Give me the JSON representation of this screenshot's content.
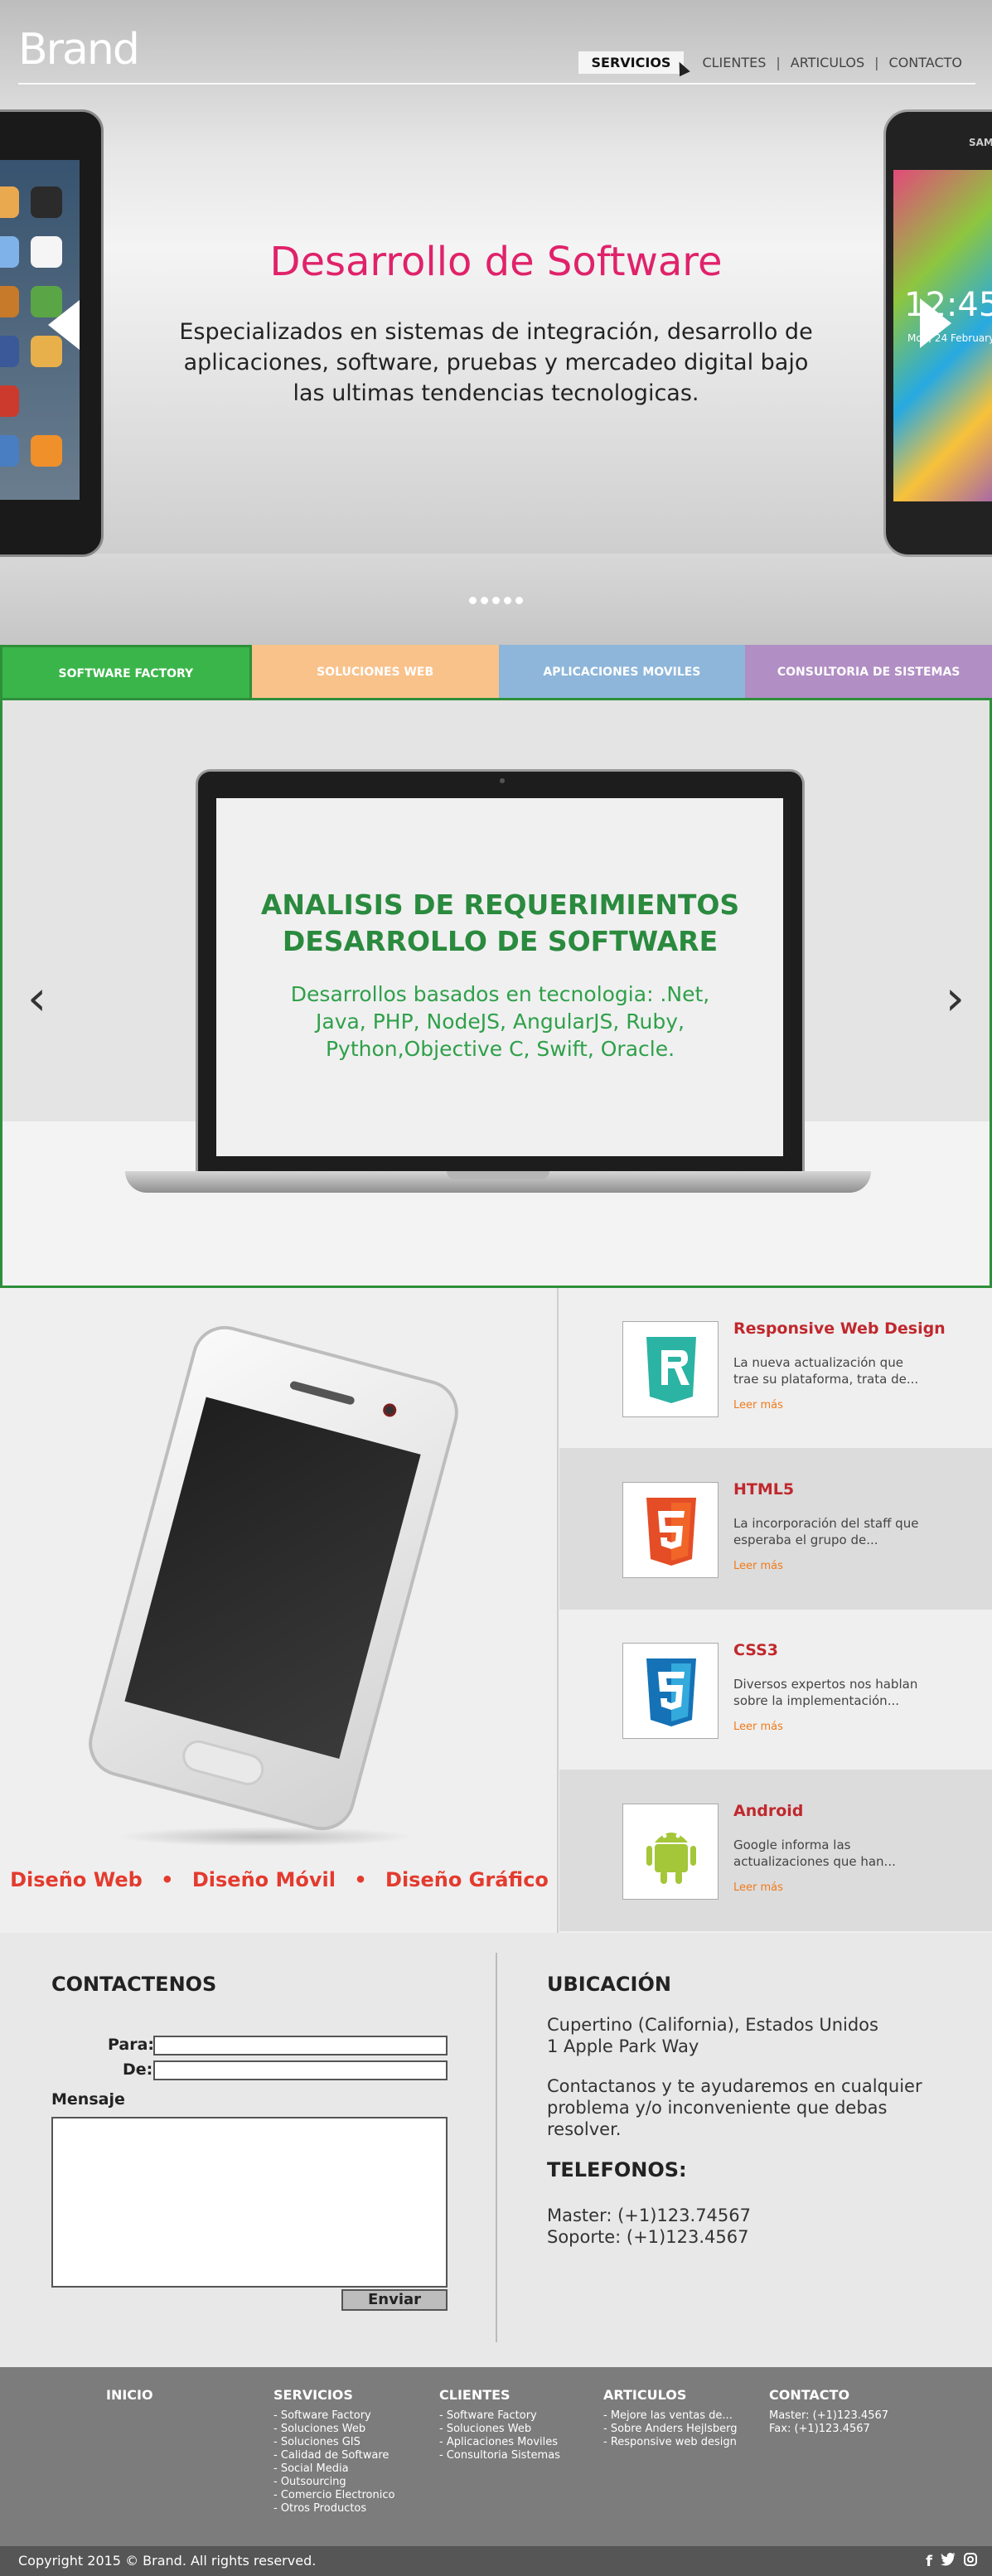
{
  "header": {
    "logo": "Brand",
    "nav": [
      {
        "label": "SERVICIOS",
        "active": true
      },
      {
        "label": "CLIENTES",
        "active": false
      },
      {
        "label": "ARTICULOS",
        "active": false
      },
      {
        "label": "CONTACTO",
        "active": false
      }
    ]
  },
  "hero": {
    "title": "Desarrollo de Software",
    "text": "Especializados en sistemas de integración, desarrollo de aplicaciones, software, pruebas y mercadeo digital bajo las ultimas tendencias tecnologicas.",
    "phone_right_brand": "SAMS",
    "phone_right_time": "12:45",
    "phone_right_date": "Mon, 24 February",
    "slide_count": 5
  },
  "tabs": [
    {
      "label": "SOFTWARE FACTORY",
      "color": "#3ab54a"
    },
    {
      "label": "SOLUCIONES WEB",
      "color": "#f9c28b"
    },
    {
      "label": "APLICACIONES MOVILES",
      "color": "#8db6da"
    },
    {
      "label": "CONSULTORIA DE SISTEMAS",
      "color": "#b18ec4"
    }
  ],
  "slide": {
    "title_line1": "ANALISIS DE REQUERIMIENTOS",
    "title_line2": "DESARROLLO DE SOFTWARE",
    "text": "Desarrollos basados en tecnologia: .Net, Java, PHP, NodeJS, AngularJS, Ruby, Python,Objective C, Swift, Oracle.",
    "prev_icon": "‹",
    "next_icon": "›"
  },
  "design": {
    "items": [
      "Diseño Web",
      "Diseño Móvil",
      "Diseño Gráfico"
    ],
    "bullet": "•"
  },
  "features": [
    {
      "title": "Responsive Web Design",
      "desc": "La nueva actualización que trae su plataforma, trata de...",
      "more": "Leer más",
      "icon": "responsive-icon",
      "icon_color": "#2bb3a3"
    },
    {
      "title": "HTML5",
      "desc": "La incorporación del staff que esperaba el grupo de...",
      "more": "Leer más",
      "icon": "html5-icon",
      "icon_color": "#e44d26"
    },
    {
      "title": "CSS3",
      "desc": "Diversos expertos nos hablan sobre la implementación...",
      "more": "Leer más",
      "icon": "css3-icon",
      "icon_color": "#1572b6"
    },
    {
      "title": "Android",
      "desc": "Google informa las actualizaciones que han...",
      "more": "Leer más",
      "icon": "android-icon",
      "icon_color": "#a4c639"
    }
  ],
  "contact": {
    "heading": "CONTACTENOS",
    "to_label": "Para:",
    "from_label": "De:",
    "message_label": "Mensaje",
    "submit": "Enviar"
  },
  "location": {
    "heading": "UBICACIÓN",
    "line1": "Cupertino (California), Estados Unidos",
    "line2": "1 Apple Park Way",
    "help": "Contactanos y te ayudaremos en cualquier problema y/o inconveniente que debas resolver.",
    "phones_heading": "TELEFONOS:",
    "master": "Master: (+1)123.74567",
    "support": "Soporte: (+1)123.4567"
  },
  "footer": {
    "columns": [
      {
        "title": "INICIO",
        "items": []
      },
      {
        "title": "SERVICIOS",
        "items": [
          "- Software Factory",
          "- Soluciones Web",
          "- Soluciones GIS",
          "- Calidad de Software",
          "- Social Media",
          "- Outsourcing",
          "- Comercio Electronico",
          "- Otros Productos"
        ]
      },
      {
        "title": "CLIENTES",
        "items": [
          "- Software Factory",
          "- Soluciones Web",
          "- Aplicaciones Moviles",
          "- Consultoria Sistemas"
        ]
      },
      {
        "title": "ARTICULOS",
        "items": [
          "- Mejore las ventas de...",
          "- Sobre Anders Hejlsberg",
          "- Responsive web design"
        ]
      },
      {
        "title": "CONTACTO",
        "items": [
          "Master: (+1)123.4567",
          "Fax: (+1)123.4567"
        ]
      }
    ],
    "copyright": "Copyright 2015 © Brand. All rights reserved.",
    "social": [
      "f",
      "t",
      "ig"
    ]
  }
}
